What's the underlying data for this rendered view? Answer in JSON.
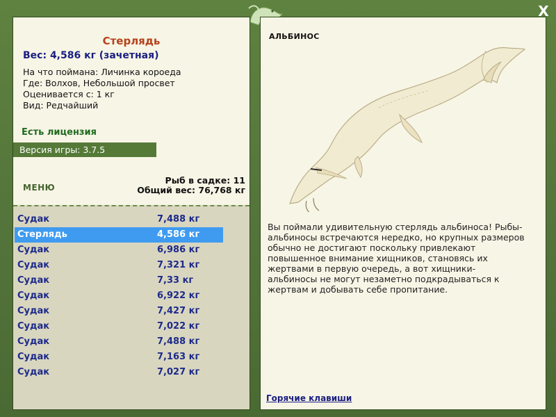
{
  "fish": {
    "name": "Стерлядь",
    "weight_line": "Вес: 4,586 кг (зачетная)",
    "bait": "На что поймана: Личинка короеда",
    "place": "Где: Волхов, Небольшой просвет",
    "rated": "Оценивается с: 1 кг",
    "kind": "Вид: Редчайший"
  },
  "license": "Есть лицензия",
  "version": "Версия игры: 3.7.5",
  "menu_label": "МЕНЮ",
  "cage": {
    "count_line": "Рыб в садке: 11",
    "total_line": "Общий вес: 76,768 кг"
  },
  "catch_list": [
    {
      "name": "Судак",
      "weight": "7,488 кг",
      "selected": false
    },
    {
      "name": "Стерлядь",
      "weight": "4,586 кг",
      "selected": true
    },
    {
      "name": "Судак",
      "weight": "6,986 кг",
      "selected": false
    },
    {
      "name": "Судак",
      "weight": "7,321 кг",
      "selected": false
    },
    {
      "name": "Судак",
      "weight": "7,33 кг",
      "selected": false
    },
    {
      "name": "Судак",
      "weight": "6,922 кг",
      "selected": false
    },
    {
      "name": "Судак",
      "weight": "7,427 кг",
      "selected": false
    },
    {
      "name": "Судак",
      "weight": "7,022 кг",
      "selected": false
    },
    {
      "name": "Судак",
      "weight": "7,488 кг",
      "selected": false
    },
    {
      "name": "Судак",
      "weight": "7,163 кг",
      "selected": false
    },
    {
      "name": "Судак",
      "weight": "7,027 кг",
      "selected": false
    }
  ],
  "detail": {
    "tag": "АЛЬБИНОС",
    "description": "Вы поймали удивительную стерлядь альбиноса! Рыбы-альбиносы встречаются нередко, но крупных размеров обычно не достигают поскольку привлекают повышенное внимание хищников, становясь их жертвами в первую очередь, а вот хищники-альбиносы не могут незаметно подкрадываться к жертвам и добывать себе пропитание.",
    "hotkeys": "Горячие клавиши"
  },
  "close_label": "X",
  "colors": {
    "frame": "#52733a",
    "panel": "#f7f5e6",
    "title": "#b5421a",
    "weight": "#1a1f80",
    "list_text": "#1c2a8a",
    "selected": "#3e9bf0",
    "license": "#1f6b1f"
  }
}
